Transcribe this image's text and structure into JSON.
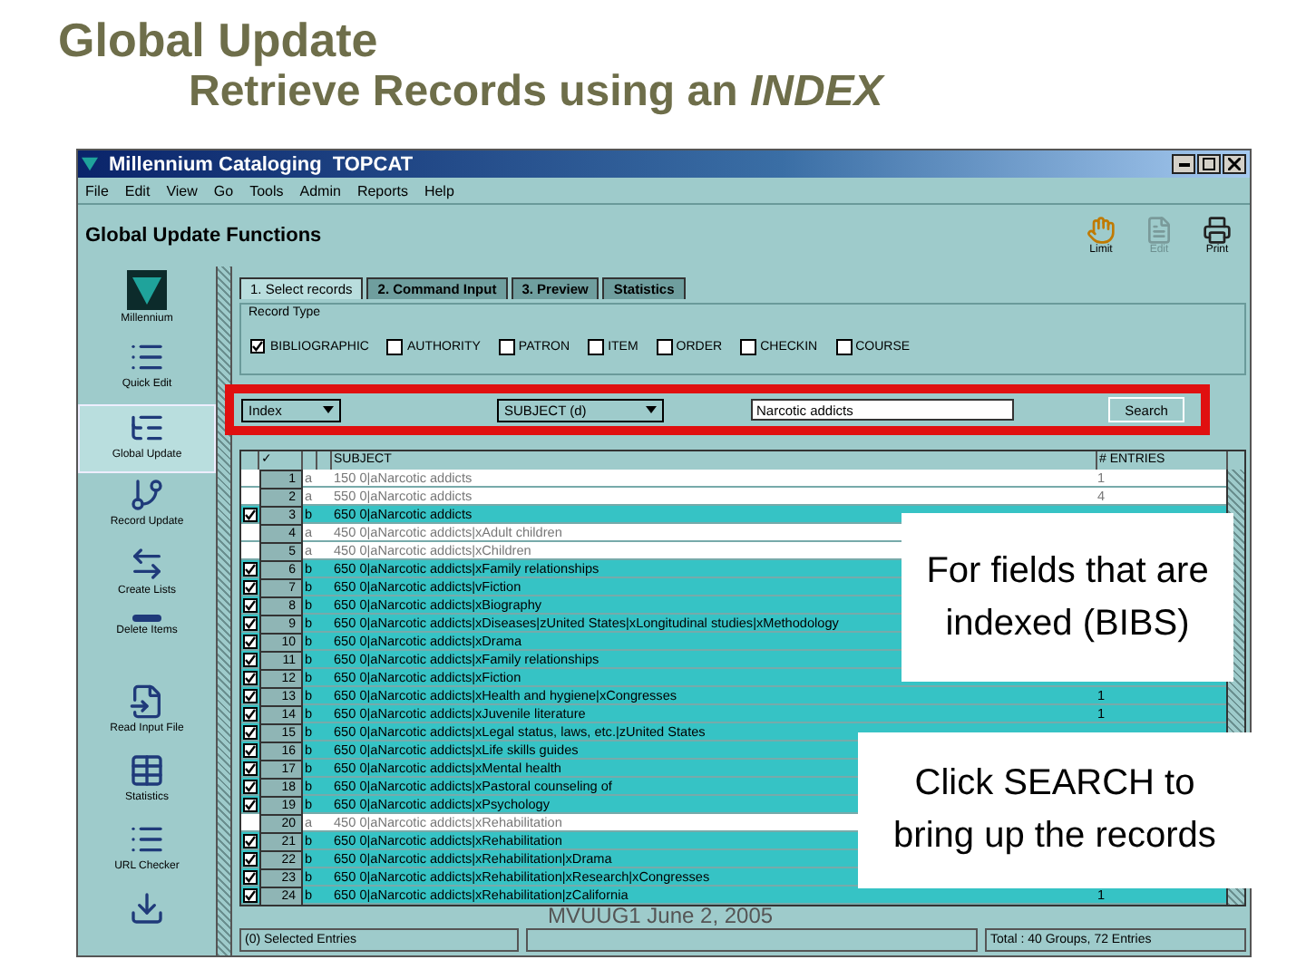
{
  "slide": {
    "title": "Global Update",
    "subtitle": "Retrieve Records using an *INDEX*",
    "footer": "MVUUG1 June 2, 2005",
    "callouts": [
      "For fields that are indexed (BIBS)",
      "Click SEARCH to bring up the records"
    ]
  },
  "window": {
    "title": "Millennium Cataloging",
    "module": "TOPCAT"
  },
  "menu": [
    "File",
    "Edit",
    "View",
    "Go",
    "Tools",
    "Admin",
    "Reports",
    "Help"
  ],
  "header": {
    "title": "Global Update Functions",
    "tools": [
      {
        "label": "Limit",
        "kind": "limit",
        "disabled": false
      },
      {
        "label": "Edit",
        "kind": "edit",
        "disabled": true
      },
      {
        "label": "Print",
        "kind": "print",
        "disabled": false
      }
    ]
  },
  "sidebar": [
    {
      "label": "Millennium",
      "kind": "logo",
      "selected": false
    },
    {
      "label": "Quick Edit",
      "kind": "edit",
      "selected": false
    },
    {
      "label": "Global Update",
      "kind": "global",
      "selected": true
    },
    {
      "label": "Record Update",
      "kind": "record",
      "selected": false
    },
    {
      "label": "Create Lists",
      "kind": "lists",
      "selected": false
    },
    {
      "label": "Delete Items",
      "kind": "delete",
      "selected": false
    },
    {
      "label": "Read Input File",
      "kind": "file",
      "selected": false
    },
    {
      "label": "Statistics",
      "kind": "stats",
      "selected": false
    },
    {
      "label": "URL Checker",
      "kind": "url",
      "selected": false
    },
    {
      "kind": "download",
      "selected": false
    }
  ],
  "tabs": [
    {
      "label": "1. Select records",
      "selected": true
    },
    {
      "label": "2. Command Input",
      "selected": false
    },
    {
      "label": "3. Preview",
      "selected": false
    },
    {
      "label": "Statistics",
      "selected": false
    }
  ],
  "record_type": {
    "label": "Record Type",
    "options": [
      {
        "label": "BIBLIOGRAPHIC",
        "checked": true
      },
      {
        "label": "AUTHORITY",
        "checked": false
      },
      {
        "label": "PATRON",
        "checked": false
      },
      {
        "label": "ITEM",
        "checked": false
      },
      {
        "label": "ORDER",
        "checked": false
      },
      {
        "label": "CHECKIN",
        "checked": false
      },
      {
        "label": "COURSE",
        "checked": false
      }
    ]
  },
  "search": {
    "index": "Index",
    "field": "SUBJECT (d)",
    "value": "Narcotic addicts",
    "button": "Search"
  },
  "table": {
    "columns": {
      "check": "✓",
      "subject": "SUBJECT",
      "entries": "# ENTRIES"
    },
    "rows": [
      {
        "num": "1",
        "code": "a",
        "subject": "150 0|aNarcotic addicts",
        "checked": false,
        "entries": "1"
      },
      {
        "num": "2",
        "code": "a",
        "subject": "550 0|aNarcotic addicts",
        "checked": false,
        "entries": "4"
      },
      {
        "num": "3",
        "code": "b",
        "subject": "650 0|aNarcotic addicts",
        "checked": true
      },
      {
        "num": "4",
        "code": "a",
        "subject": "450 0|aNarcotic addicts|xAdult children",
        "checked": false
      },
      {
        "num": "5",
        "code": "a",
        "subject": "450 0|aNarcotic addicts|xChildren",
        "checked": false
      },
      {
        "num": "6",
        "code": "b",
        "subject": "650 0|aNarcotic addicts|xFamily relationships",
        "checked": true
      },
      {
        "num": "7",
        "code": "b",
        "subject": "650 0|aNarcotic addicts|vFiction",
        "checked": true
      },
      {
        "num": "8",
        "code": "b",
        "subject": "650 0|aNarcotic addicts|xBiography",
        "checked": true
      },
      {
        "num": "9",
        "code": "b",
        "subject": "650 0|aNarcotic addicts|xDiseases|zUnited States|xLongitudinal studies|xMethodology",
        "checked": true
      },
      {
        "num": "10",
        "code": "b",
        "subject": "650 0|aNarcotic addicts|xDrama",
        "checked": true
      },
      {
        "num": "11",
        "code": "b",
        "subject": "650 0|aNarcotic addicts|xFamily relationships",
        "checked": true
      },
      {
        "num": "12",
        "code": "b",
        "subject": "650 0|aNarcotic addicts|xFiction",
        "checked": true
      },
      {
        "num": "13",
        "code": "b",
        "subject": "650 0|aNarcotic addicts|xHealth and hygiene|xCongresses",
        "checked": true,
        "entries": "1"
      },
      {
        "num": "14",
        "code": "b",
        "subject": "650 0|aNarcotic addicts|xJuvenile literature",
        "checked": true,
        "entries": "1"
      },
      {
        "num": "15",
        "code": "b",
        "subject": "650 0|aNarcotic addicts|xLegal status, laws, etc.|zUnited States",
        "checked": true
      },
      {
        "num": "16",
        "code": "b",
        "subject": "650 0|aNarcotic addicts|xLife skills guides",
        "checked": true
      },
      {
        "num": "17",
        "code": "b",
        "subject": "650 0|aNarcotic addicts|xMental health",
        "checked": true
      },
      {
        "num": "18",
        "code": "b",
        "subject": "650 0|aNarcotic addicts|xPastoral counseling of",
        "checked": true
      },
      {
        "num": "19",
        "code": "b",
        "subject": "650 0|aNarcotic addicts|xPsychology",
        "checked": true
      },
      {
        "num": "20",
        "code": "a",
        "subject": "450 0|aNarcotic addicts|xRehabilitation",
        "checked": false
      },
      {
        "num": "21",
        "code": "b",
        "subject": "650 0|aNarcotic addicts|xRehabilitation",
        "checked": true
      },
      {
        "num": "22",
        "code": "b",
        "subject": "650 0|aNarcotic addicts|xRehabilitation|xDrama",
        "checked": true
      },
      {
        "num": "23",
        "code": "b",
        "subject": "650 0|aNarcotic addicts|xRehabilitation|xResearch|xCongresses",
        "checked": true
      },
      {
        "num": "24",
        "code": "b",
        "subject": "650 0|aNarcotic addicts|xRehabilitation|zCalifornia",
        "checked": true,
        "entries": "1"
      }
    ]
  },
  "status_bar": [
    "(0) Selected Entries",
    "Total : 40 Groups, 72 Entries"
  ]
}
